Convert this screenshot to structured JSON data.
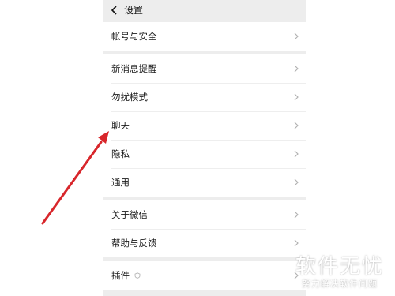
{
  "header": {
    "title": "设置"
  },
  "groups": [
    {
      "items": [
        {
          "label": "帐号与安全"
        }
      ]
    },
    {
      "items": [
        {
          "label": "新消息提醒"
        },
        {
          "label": "勿扰模式"
        },
        {
          "label": "聊天"
        },
        {
          "label": "隐私"
        },
        {
          "label": "通用"
        }
      ]
    },
    {
      "items": [
        {
          "label": "关于微信"
        },
        {
          "label": "帮助与反馈"
        }
      ]
    },
    {
      "items": [
        {
          "label": "插件"
        }
      ]
    }
  ],
  "icons": {
    "back": "chevron-left-icon",
    "chevron": "chevron-right-icon",
    "plugin": "plugin-icon"
  },
  "colors": {
    "background": "#ededed",
    "annotation_arrow": "#d8262b"
  },
  "watermark": {
    "title": "软件无忧",
    "subtitle": "努力解决软件问题"
  }
}
